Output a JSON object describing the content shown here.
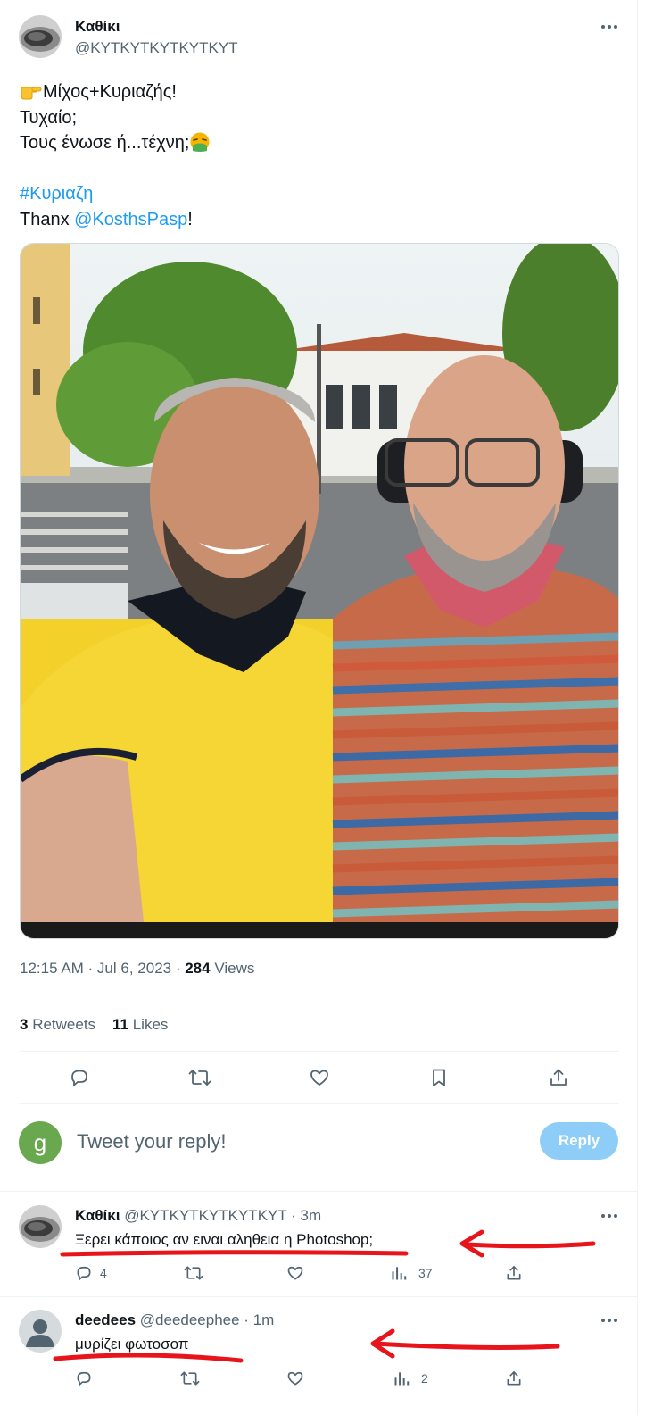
{
  "tweet": {
    "author_name": "Καθίκι",
    "author_handle": "@KYTKYTKYTKYTKYT",
    "text_lines": [
      "Μίχος+Κυριαζής!",
      "Τυχαίο;",
      "Τους ένωσε ή...τέχνη;",
      "",
      "#Κυριαζη",
      "Thanx "
    ],
    "hashtag": "#Κυριαζη",
    "thanx_prefix": "Thanx ",
    "mention": "@KosthsPasp",
    "thanx_suffix": "!",
    "timestamp": "12:15 AM · Jul 6, 2023 · ",
    "views_count": "284",
    "views_label": " Views",
    "retweets_count": "3",
    "retweets_label": " Retweets",
    "likes_count": "11",
    "likes_label": " Likes"
  },
  "reply_box": {
    "avatar_letter": "g",
    "avatar_color": "#6aa84f",
    "placeholder": "Tweet your reply!",
    "button_label": "Reply"
  },
  "replies": [
    {
      "author_name": "Καθίκι",
      "meta": "@KYTKYTKYTKYTKYT · 3m",
      "text": "Ξερει κάποιος αν ειναι αληθεια η Photoshop;",
      "reply_count": "4",
      "retweet_count": "",
      "like_count": "",
      "views_count": "37"
    },
    {
      "author_name": "deedees",
      "meta": "@deedeephee · 1m",
      "text": "μυρίζει φωτοσοπ",
      "reply_count": "",
      "retweet_count": "",
      "like_count": "",
      "views_count": "2"
    }
  ],
  "colors": {
    "link": "#1d9bf0",
    "annotation_red": "#e8141b",
    "reply_button_disabled": "#8ecdf7"
  },
  "icons": [
    "more-icon",
    "reply-icon",
    "retweet-icon",
    "like-icon",
    "bookmark-icon",
    "share-icon",
    "views-icon",
    "point-emoji-icon",
    "nauseated-emoji-icon"
  ]
}
